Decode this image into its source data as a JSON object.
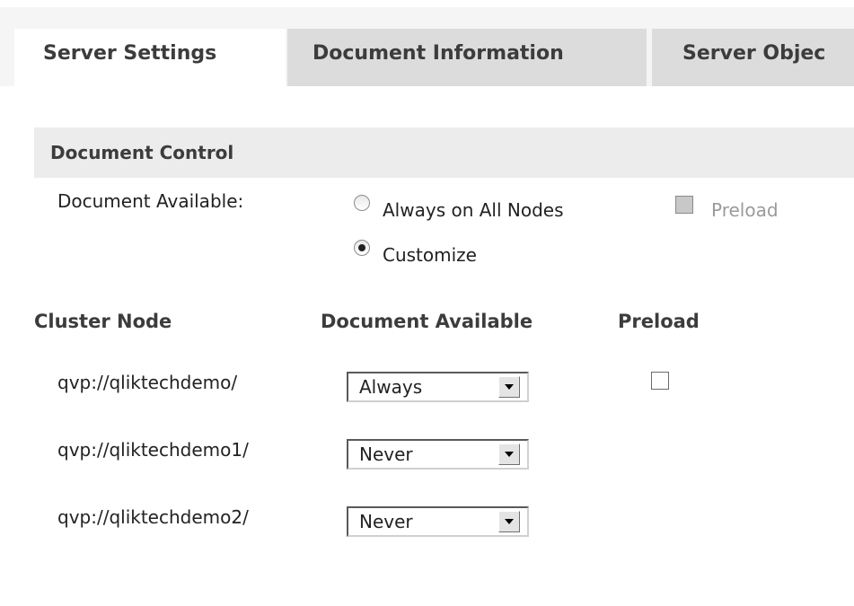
{
  "tabs": [
    {
      "label": "Server Settings",
      "active": true
    },
    {
      "label": "Document Information",
      "active": false
    },
    {
      "label": "Server Objec",
      "active": false
    }
  ],
  "document_control": {
    "title": "Document Control",
    "available_label": "Document Available:",
    "options": [
      {
        "label": "Always on All Nodes",
        "selected": false
      },
      {
        "label": "Customize",
        "selected": true
      }
    ],
    "preload_label": "Preload",
    "preload_enabled": false,
    "preload_checked": false
  },
  "cluster_table": {
    "headers": [
      "Cluster Node",
      "Document Available",
      "Preload"
    ],
    "rows": [
      {
        "node": "qvp://qliktechdemo/",
        "availability": "Always",
        "preload_visible": true,
        "preload_checked": false
      },
      {
        "node": "qvp://qliktechdemo1/",
        "availability": "Never",
        "preload_visible": false
      },
      {
        "node": "qvp://qliktechdemo2/",
        "availability": "Never",
        "preload_visible": false
      }
    ]
  },
  "colors": {
    "tab_active_bg": "#ffffff",
    "tab_inactive_bg": "#dcdcdc",
    "section_header_bg": "#ececec",
    "disabled_text": "#9a9a9a"
  }
}
